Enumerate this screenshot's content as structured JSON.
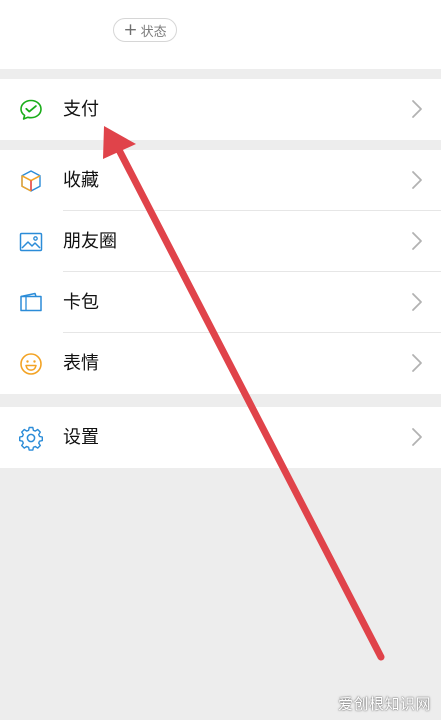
{
  "status": {
    "plus": "+",
    "label": "状态"
  },
  "menu": {
    "pay": {
      "label": "支付",
      "icon": "wechat-pay-icon"
    },
    "favorites": {
      "label": "收藏",
      "icon": "cube-icon"
    },
    "moments": {
      "label": "朋友圈",
      "icon": "picture-icon"
    },
    "cards": {
      "label": "卡包",
      "icon": "card-icon"
    },
    "stickers": {
      "label": "表情",
      "icon": "smiley-icon"
    },
    "settings": {
      "label": "设置",
      "icon": "gear-icon"
    }
  },
  "watermark": "爱创根知识网",
  "colors": {
    "background": "#ededed",
    "arrow": "#e0434a",
    "pay_icon": "#1aad19",
    "settings_icon": "#2b8cd8"
  }
}
